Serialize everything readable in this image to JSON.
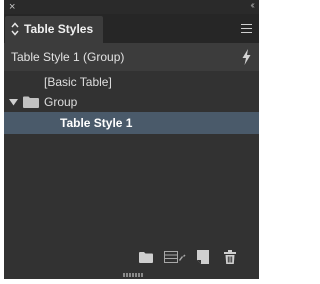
{
  "window": {
    "close_glyph": "×",
    "collapse_glyph": "‹‹"
  },
  "tab": {
    "label": "Table Styles",
    "icon": "up-down-arrows-icon"
  },
  "panel_menu": {
    "icon": "panel-menu-icon"
  },
  "header": {
    "current_style": "Table Style 1 (Group)",
    "clear_overrides_icon": "lightning-icon"
  },
  "styles_list": {
    "items": [
      {
        "label": "[Basic Table]",
        "type": "style",
        "selected": false
      },
      {
        "label": "Group",
        "type": "group",
        "expanded": true,
        "icon": "folder-icon",
        "selected": false
      },
      {
        "label": "Table Style 1",
        "type": "style",
        "selected": true
      }
    ]
  },
  "footer": {
    "buttons": [
      {
        "name": "new-group-button",
        "icon": "folder-icon"
      },
      {
        "name": "load-styles-button",
        "icon": "style-list-icon"
      },
      {
        "name": "new-style-button",
        "icon": "new-page-icon"
      },
      {
        "name": "delete-style-button",
        "icon": "trash-icon"
      }
    ]
  },
  "colors": {
    "panel_bg": "#323232",
    "tab_bg": "#3c3c3c",
    "selection": "#4a5a6a",
    "text": "#dedede"
  }
}
